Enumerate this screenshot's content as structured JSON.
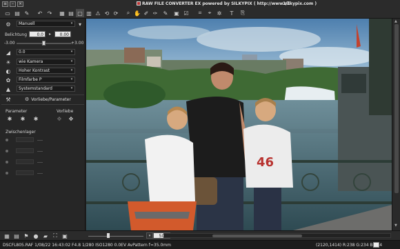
{
  "window": {
    "title": "RAW FILE CONVERTER EX powered by SILKYPIX ( http://www.silkypix.com )",
    "page_counter": "1/1"
  },
  "toolbar": {
    "icons": [
      "open-folder-icon",
      "save-icon",
      "batch-icon",
      "undo-icon",
      "redo-icon",
      "grid-view-icon",
      "filmstrip-view-icon",
      "single-view-icon",
      "compare-view-icon",
      "warning-icon",
      "rotate-left-icon",
      "rotate-right-icon",
      "zoom-icon",
      "hand-icon",
      "wb-picker-icon",
      "gray-picker-icon",
      "tone-picker-icon",
      "mark-icon",
      "color-check-icon",
      "crop-icon",
      "straighten-icon",
      "spot-icon",
      "text-icon",
      "paste-icon"
    ]
  },
  "panel": {
    "preset_dropdown": "Manuell",
    "exposure_label": "Belichtung",
    "exposure_value": "0.0",
    "exposure_second_value": "0.00",
    "exposure_min": "-3.00",
    "exposure_max": "+3.00",
    "white_balance": "0.0",
    "wb_mode": "wie Kamera",
    "tone": "Hoher Kontrast",
    "color": "Filmfarbe P",
    "sharpness": "Systemstandard",
    "presets_button": "Vorliebe/Parameter",
    "params_label": "Parameter",
    "prefs_label": "Vorliebe",
    "buffer_label": "Zwischenlager"
  },
  "viewer": {
    "zoom": "50"
  },
  "status": {
    "file_info": "DSCFL805.RAF 1/08/22 16:43:02 F4.8 1/280 ISO1280 0.0EV AvPattern f=35.0mm",
    "pixel_info": "(2120,1414) R:238 G:234 B:234"
  },
  "colors": {
    "accent_logo": "#b33333",
    "panel_bg": "#262626",
    "field_bg": "#1a1a1a"
  }
}
